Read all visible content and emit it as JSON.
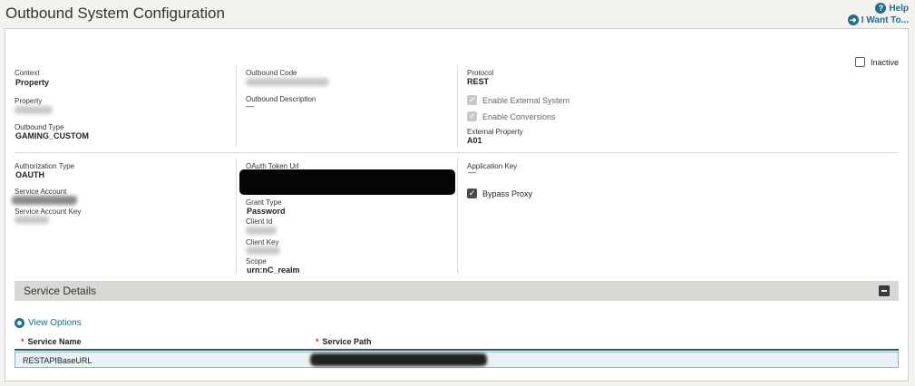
{
  "header": {
    "title": "Outbound System Configuration",
    "help_label": "Help",
    "help_icon_glyph": "?",
    "iwant_label": "I Want To...",
    "iwant_icon_glyph": "➜"
  },
  "inactive": {
    "label": "Inactive",
    "checked": false
  },
  "col1": {
    "context_label": "Context",
    "context_value": "Property",
    "property_label": "Property",
    "outbound_type_label": "Outbound Type",
    "outbound_type_value": "GAMING_CUSTOM"
  },
  "col2": {
    "outbound_code_label": "Outbound Code",
    "outbound_desc_label": "Outbound Description",
    "outbound_desc_value": "—"
  },
  "col3": {
    "protocol_label": "Protocol",
    "protocol_value": "REST",
    "enable_external_label": "Enable External System",
    "enable_conversions_label": "Enable Conversions",
    "external_property_label": "External Property",
    "external_property_value": "A01"
  },
  "auth": {
    "auth_type_label": "Authorization Type",
    "auth_type_value": "OAUTH",
    "service_account_label": "Service Account",
    "service_account_key_label": "Service Account Key"
  },
  "oauth": {
    "token_url_label": "OAuth Token Url",
    "grant_type_label": "Grant Type",
    "grant_type_value": "Password",
    "client_id_label": "Client Id",
    "client_key_label": "Client Key",
    "scope_label": "Scope",
    "scope_value": "urn:nC_realm"
  },
  "appkey": {
    "app_key_label": "Application Key",
    "app_key_value": "—",
    "bypass_proxy_label": "Bypass Proxy"
  },
  "service_details": {
    "title": "Service Details",
    "view_options_label": "View Options",
    "required_marker": "*",
    "columns": [
      "Service Name",
      "Service Path"
    ],
    "rows": [
      {
        "name": "RESTAPIBaseURL"
      }
    ]
  },
  "colors": {
    "accent": "#1f6f86",
    "section_bar": "#d9d8d4",
    "row_highlight": "#e8f1f4"
  }
}
